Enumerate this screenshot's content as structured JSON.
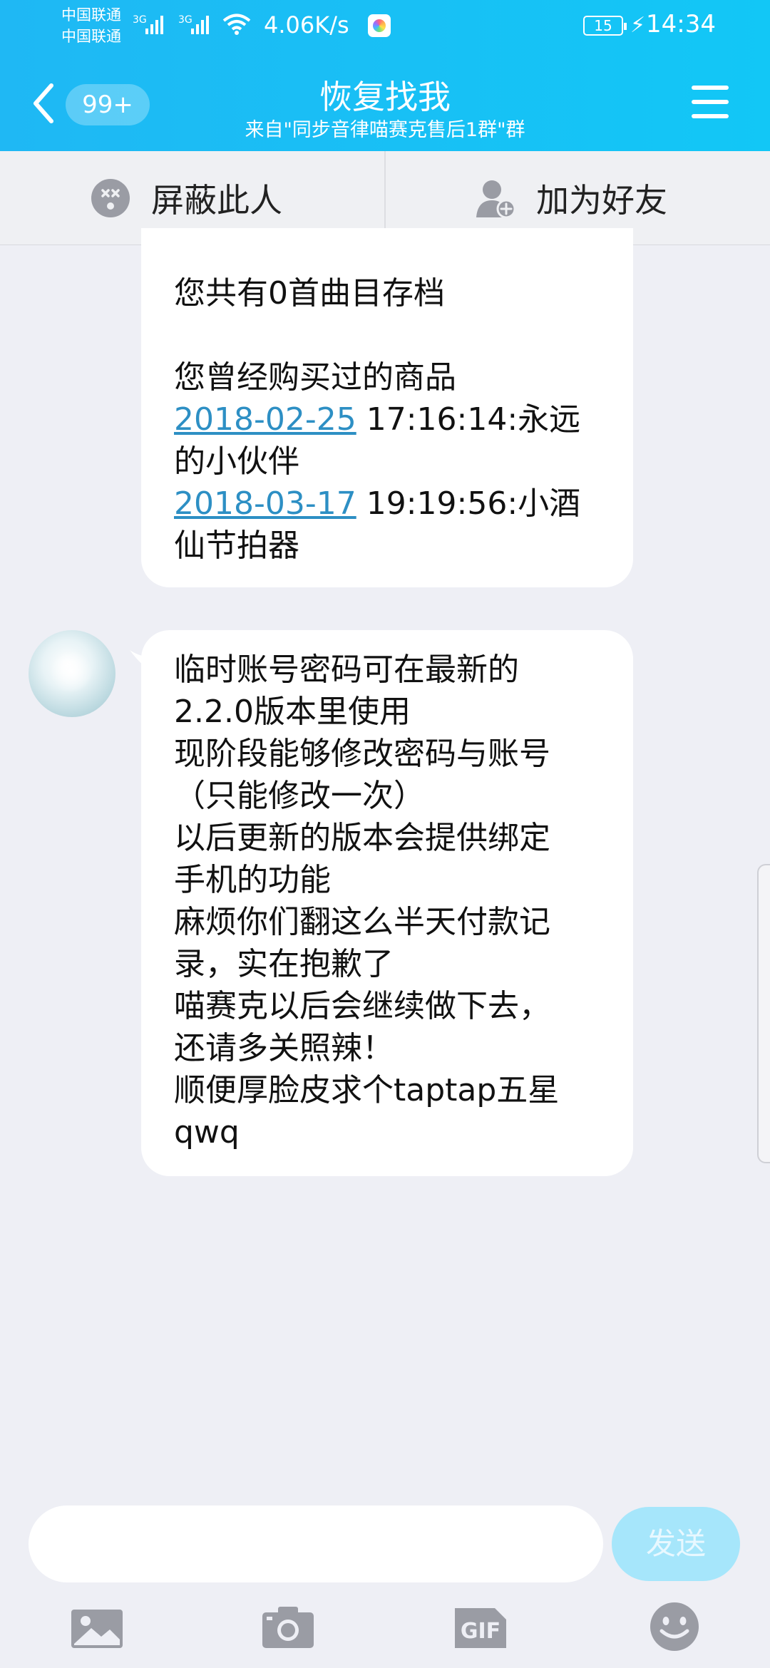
{
  "status_bar": {
    "carrier1": "中国联通",
    "carrier2": "中国联通",
    "network1": "3G",
    "network2": "3G",
    "net_speed": "4.06K/s",
    "battery": "15",
    "time": "14:34"
  },
  "header": {
    "unread_badge": "99+",
    "title": "恢复找我",
    "subtitle": "来自\"同步音律喵赛克售后1群\"群"
  },
  "actions": {
    "block_label": "屏蔽此人",
    "add_friend_label": "加为好友"
  },
  "messages": [
    {
      "lines": [
        "您共有0首曲目存档",
        "",
        "您曾经购买过的商品"
      ],
      "purchases": [
        {
          "date": "2018-02-25",
          "rest1": " 17:16:14:永远",
          "rest2": "的小伙伴"
        },
        {
          "date": "2018-03-17",
          "rest1": " 19:19:56:小酒",
          "rest2": "仙节拍器"
        }
      ]
    },
    {
      "lines": [
        "临时账号密码可在最新的",
        "2.2.0版本里使用",
        "现阶段能够修改密码与账号",
        "（只能修改一次）",
        "以后更新的版本会提供绑定",
        "手机的功能",
        "麻烦你们翻这么半天付款记",
        "录，实在抱歉了",
        "喵赛克以后会继续做下去，",
        "还请多关照辣！",
        "顺便厚脸皮求个taptap五星",
        "qwq"
      ]
    }
  ],
  "input": {
    "placeholder": "",
    "send_label": "发送"
  },
  "toolbar": {
    "gif_label": "GIF",
    "icons": [
      "image-icon",
      "camera-icon",
      "gif-icon",
      "emoji-icon"
    ]
  },
  "colors": {
    "header": "#1fb8f4",
    "link": "#2d8fc4",
    "send_disabled": "#a6e6fb",
    "background": "#eeeff5"
  }
}
